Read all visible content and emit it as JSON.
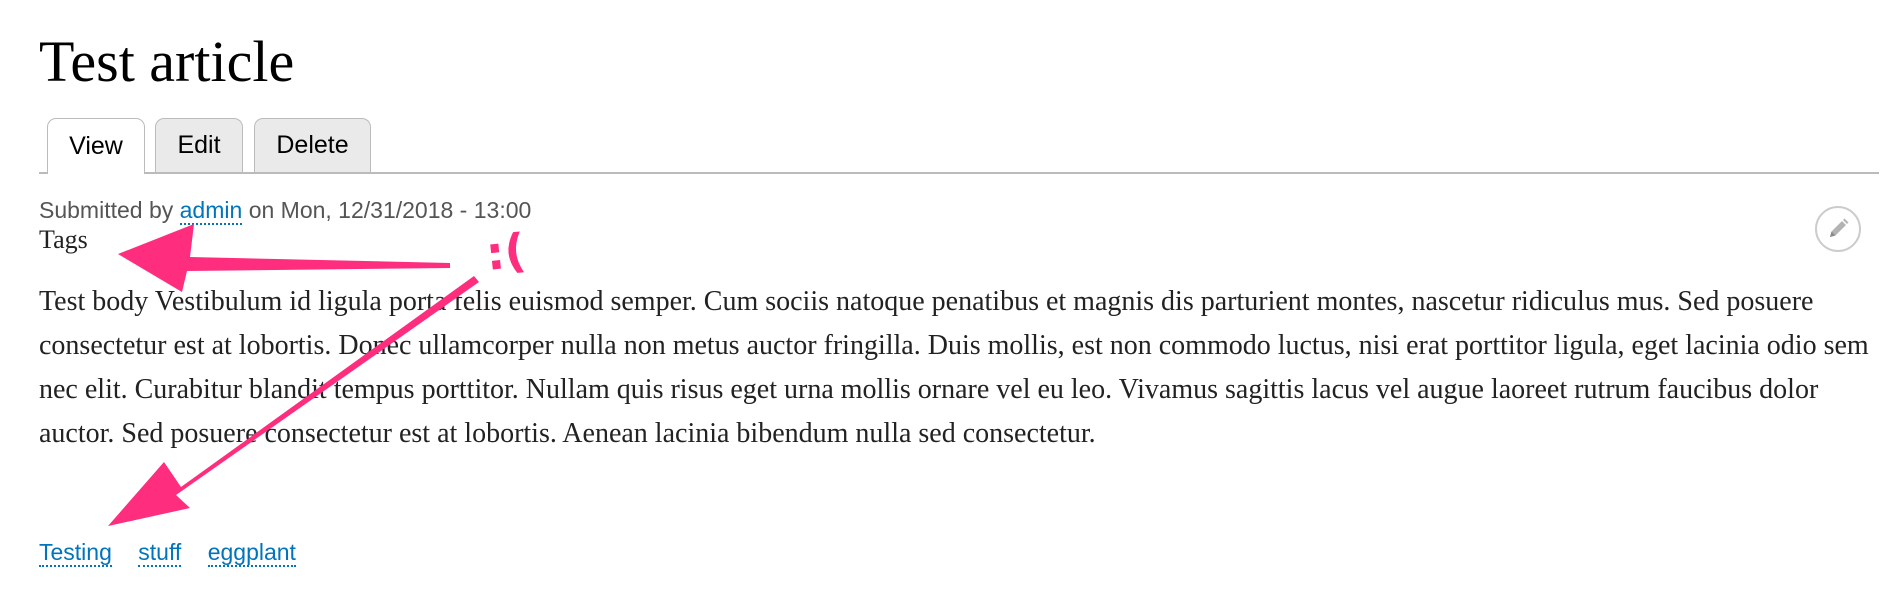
{
  "page": {
    "title": "Test article"
  },
  "tabs": [
    {
      "label": "View",
      "active": true
    },
    {
      "label": "Edit",
      "active": false
    },
    {
      "label": "Delete",
      "active": false
    }
  ],
  "submitted": {
    "prefix": "Submitted by",
    "author": "admin",
    "date_text": "on Mon, 12/31/2018 - 13:00"
  },
  "tags_heading": "Tags",
  "body": "Test body Vestibulum id ligula porta felis euismod semper. Cum sociis natoque penatibus et magnis dis parturient montes, nascetur ridiculus mus. Sed posuere consectetur est at lobortis. Donec ullamcorper nulla non metus auctor fringilla. Duis mollis, est non commodo luctus, nisi erat porttitor ligula, eget lacinia odio sem nec elit. Curabitur blandit tempus porttitor. Nullam quis risus eget urna mollis ornare vel eu leo. Vivamus sagittis lacus vel augue laoreet rutrum faucibus dolor auctor. Sed posuere consectetur est at lobortis. Aenean lacinia bibendum nulla sed consectetur.",
  "tag_links": [
    "Testing",
    "stuff",
    "eggplant"
  ],
  "annotation": {
    "text": ":(",
    "color": "#ff2d7e"
  },
  "icons": {
    "edit": "pencil-icon"
  },
  "colors": {
    "link": "#0074bd",
    "meta_text": "#555555",
    "tab_background": "#eaeaea",
    "annotation": "#ff2d7e"
  }
}
